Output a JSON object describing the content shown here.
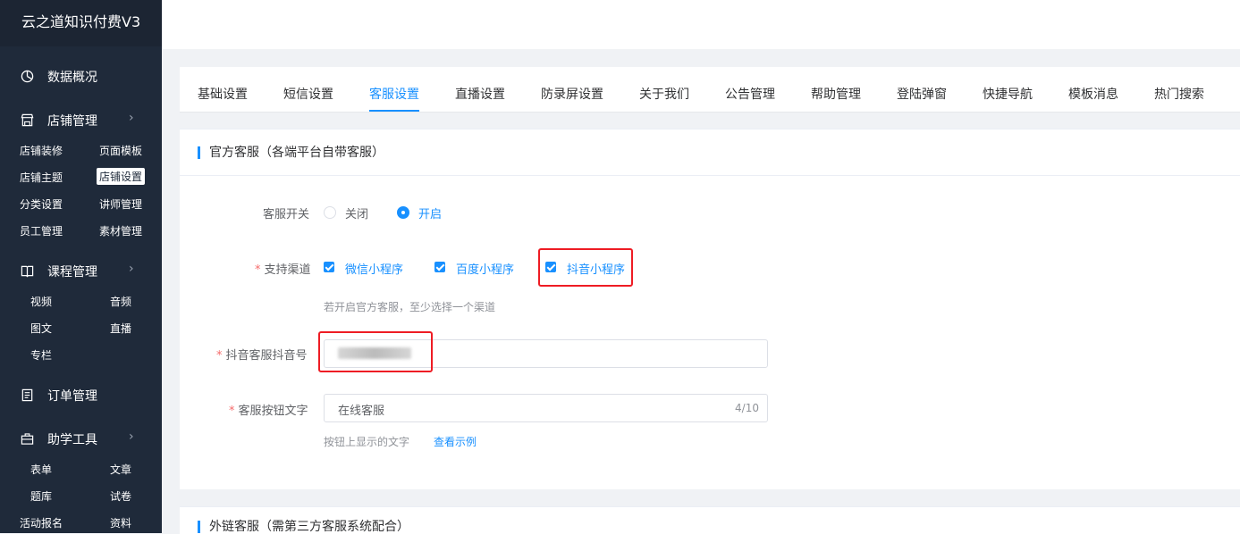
{
  "app": {
    "title": "云之道知识付费V3"
  },
  "sidebar": {
    "groups": [
      {
        "label": "数据概况",
        "icon": "pie-chart-icon"
      },
      {
        "label": "店铺管理",
        "icon": "shop-icon"
      },
      {
        "label": "课程管理",
        "icon": "book-icon"
      },
      {
        "label": "订单管理",
        "icon": "order-icon"
      },
      {
        "label": "助学工具",
        "icon": "toolbox-icon"
      }
    ],
    "shop_items": [
      "店铺装修",
      "页面模板",
      "店铺主题",
      "店铺设置",
      "分类设置",
      "讲师管理",
      "员工管理",
      "素材管理"
    ],
    "course_items": [
      "视频",
      "音频",
      "图文",
      "直播",
      "专栏"
    ],
    "tool_items": [
      "表单",
      "文章",
      "题库",
      "试卷",
      "活动报名",
      "资料"
    ],
    "active_item": "店铺设置"
  },
  "tabs": [
    "基础设置",
    "短信设置",
    "客服设置",
    "直播设置",
    "防录屏设置",
    "关于我们",
    "公告管理",
    "帮助管理",
    "登陆弹窗",
    "快捷导航",
    "模板消息",
    "热门搜索"
  ],
  "active_tab": "客服设置",
  "official": {
    "title": "官方客服（各端平台自带客服）",
    "switch_label": "客服开关",
    "switch_options": [
      "关闭",
      "开启"
    ],
    "switch_value": "开启",
    "channels_label": "支持渠道",
    "channels": [
      "微信小程序",
      "百度小程序",
      "抖音小程序"
    ],
    "channels_checked": [
      true,
      true,
      true
    ],
    "channels_hint": "若开启官方客服，至少选择一个渠道",
    "douyin_label": "抖音客服抖音号",
    "douyin_value": "",
    "button_text_label": "客服按钮文字",
    "button_text_value": "在线客服",
    "button_text_count": "4/10",
    "button_text_hint": "按钮上显示的文字",
    "example_link": "查看示例"
  },
  "external": {
    "title": "外链客服（需第三方客服系统配合）"
  },
  "colors": {
    "sidebar_bg": "#1f2a3a",
    "accent": "#1890ff",
    "highlight": "#ee1c24"
  }
}
